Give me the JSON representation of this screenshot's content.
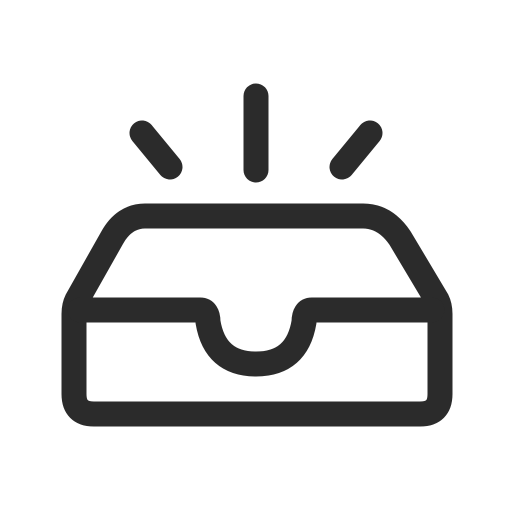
{
  "icon": {
    "name": "inbox-new-icon",
    "description_label": "",
    "stroke_color": "#2b2b2b",
    "background_color": "#ffffff"
  }
}
